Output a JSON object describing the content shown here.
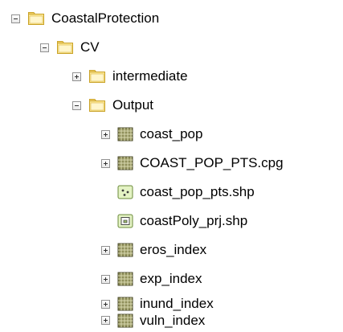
{
  "tree": {
    "items": [
      {
        "label": "CoastalProtection",
        "icon": "folder-icon",
        "expander": "expanded"
      },
      {
        "label": "CV",
        "icon": "folder-icon",
        "expander": "expanded"
      },
      {
        "label": "intermediate",
        "icon": "folder-icon",
        "expander": "collapsed"
      },
      {
        "label": "Output",
        "icon": "folder-icon",
        "expander": "expanded"
      },
      {
        "label": "coast_pop",
        "icon": "raster-icon",
        "expander": "collapsed"
      },
      {
        "label": "COAST_POP_PTS.cpg",
        "icon": "raster-icon",
        "expander": "collapsed"
      },
      {
        "label": "coast_pop_pts.shp",
        "icon": "point-feature-icon",
        "expander": "none"
      },
      {
        "label": "coastPoly_prj.shp",
        "icon": "polygon-feature-icon",
        "expander": "none"
      },
      {
        "label": "eros_index",
        "icon": "raster-icon",
        "expander": "collapsed"
      },
      {
        "label": "exp_index",
        "icon": "raster-icon",
        "expander": "collapsed"
      },
      {
        "label": "inund_index",
        "icon": "raster-icon",
        "expander": "collapsed"
      },
      {
        "label": "vuln_index",
        "icon": "raster-icon",
        "expander": "collapsed"
      }
    ]
  },
  "colors": {
    "folder_body": "#fbe694",
    "folder_border": "#c9a227",
    "raster_fill": "#8f8f5a",
    "raster_border": "#4a4a2a",
    "feature_fill": "#e4f3c4",
    "feature_border": "#6a8a3a"
  }
}
